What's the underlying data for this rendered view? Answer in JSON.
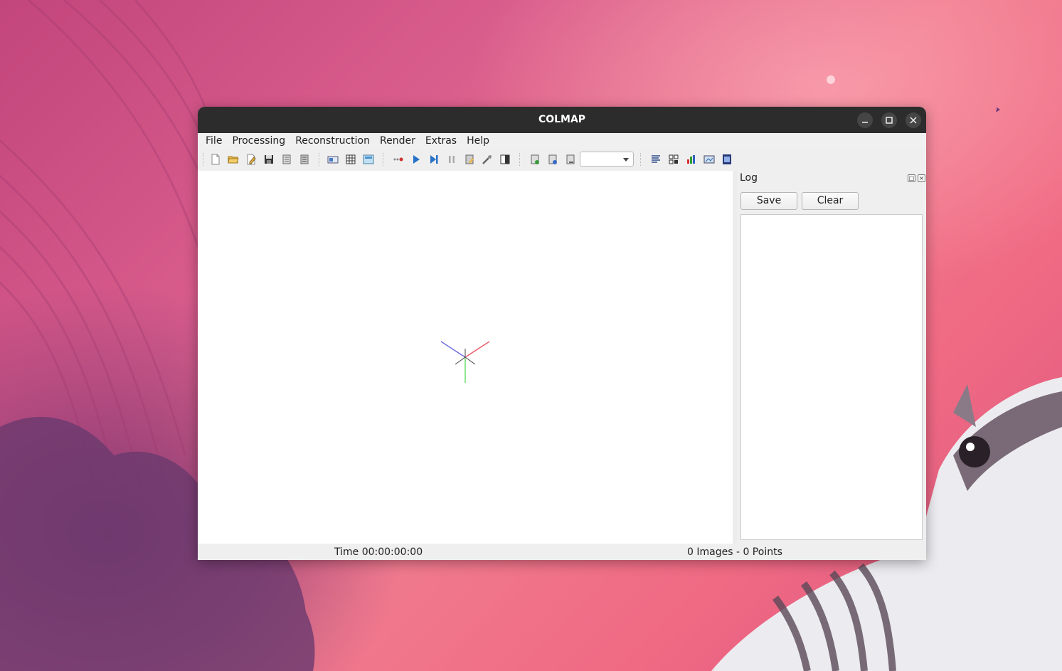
{
  "window": {
    "title": "COLMAP",
    "controls": [
      "minimize-icon",
      "maximize-icon",
      "close-icon"
    ]
  },
  "menu": {
    "items": [
      "File",
      "Processing",
      "Reconstruction",
      "Render",
      "Extras",
      "Help"
    ]
  },
  "toolbar": {
    "icons": [
      "new-project-icon",
      "open-project-icon",
      "edit-project-icon",
      "save-project-icon",
      "import-model-icon",
      "export-model-icon",
      "feature-extraction-icon",
      "feature-matching-icon",
      "database-management-icon",
      "automatic-reconstruction-icon",
      "start-reconstruction-icon",
      "step-reconstruction-icon",
      "pause-reconstruction-icon",
      "bundle-adjustment-icon",
      "tools-icon",
      "render-options-icon",
      "reset-view-icon",
      "render-sub-icon",
      "remove-model-icon",
      "log-icon",
      "match-matrix-icon",
      "statistics-icon",
      "screenshot-icon",
      "grab-movie-icon"
    ],
    "model_selector_value": ""
  },
  "log": {
    "title": "Log",
    "save_label": "Save",
    "clear_label": "Clear",
    "content": ""
  },
  "status": {
    "time": "Time 00:00:00:00",
    "counts": "0 Images - 0 Points"
  },
  "colors": {
    "titlebar": "#2c2c2c",
    "axis_x": "#e85c6a",
    "axis_y": "#6bdd6b",
    "axis_z": "#7070e0"
  }
}
